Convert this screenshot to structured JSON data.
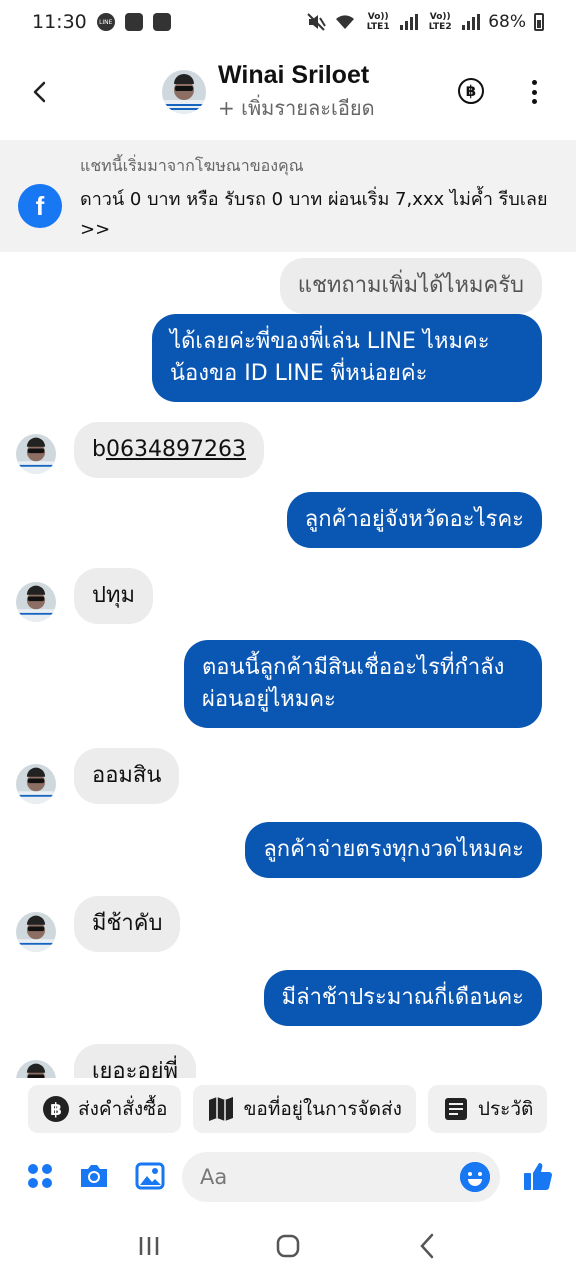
{
  "status_bar": {
    "time": "11:30",
    "line_badge": "LINE",
    "lte1": "Vo)) LTE1",
    "lte2": "Vo)) LTE2",
    "battery": "68%"
  },
  "header": {
    "name": "Winai Sriloet",
    "subtitle": "+ เพิ่มรายละเอียด",
    "baht_symbol": "฿"
  },
  "ad_banner": {
    "title": "แชทนี้เริ่มมาจากโฆษณาของคุณ",
    "body": "ดาวน์ 0 บาท หรือ รับรถ 0 บาท ผ่อนเริ่ม 7,xxx ไม่ค้ำ รีบเลย >>",
    "icon_letter": "f"
  },
  "messages": [
    {
      "side": "in",
      "text": "แชทถามเพิ่มได้ไหมครับ"
    },
    {
      "side": "out",
      "text": "ได้เลยค่ะพี่ของพี่เล่น LINE ไหมคะ น้องขอ ID LINE พี่หน่อยค่ะ"
    },
    {
      "side": "in",
      "prefix": "b",
      "link": "0634897263"
    },
    {
      "side": "out",
      "text": "ลูกค้าอยู่จังหวัดอะไรคะ"
    },
    {
      "side": "in",
      "text": "ปทุม"
    },
    {
      "side": "out",
      "text": "ตอนนี้ลูกค้ามีสินเชื่ออะไรที่กำลังผ่อนอยู่ไหมคะ"
    },
    {
      "side": "in",
      "text": "ออมสิน"
    },
    {
      "side": "out",
      "text": "ลูกค้าจ่ายตรงทุกงวดไหมคะ"
    },
    {
      "side": "in",
      "text": "มีช้าคับ"
    },
    {
      "side": "out",
      "text": "มีล่าช้าประมาณกี่เดือนคะ"
    },
    {
      "side": "in",
      "text": "เยอะอยู่พี่"
    }
  ],
  "quick_replies": [
    {
      "label": "ส่งคำสั่งซื้อ",
      "icon": "baht-icon"
    },
    {
      "label": "ขอที่อยู่ในการจัดส่ง",
      "icon": "map-icon"
    },
    {
      "label": "ประวัติ",
      "icon": "document-icon"
    }
  ],
  "composer": {
    "placeholder": "Aa"
  },
  "colors": {
    "outgoing_bubble": "#0a56b3",
    "incoming_bubble": "#ececec",
    "accent": "#1877f2"
  }
}
